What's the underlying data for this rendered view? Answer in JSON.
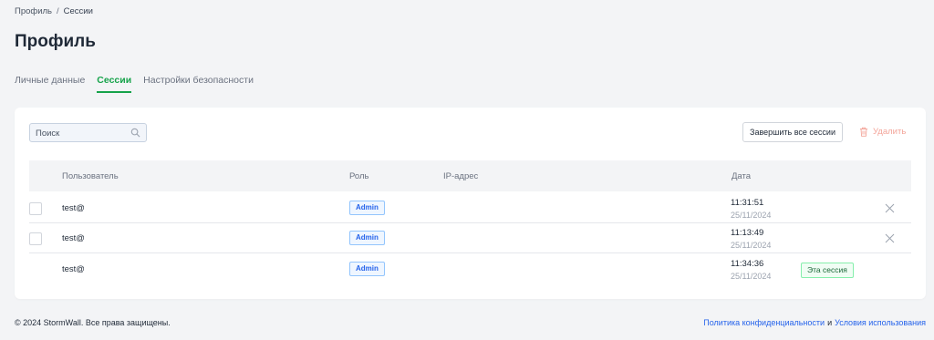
{
  "breadcrumb": {
    "parent": "Профиль",
    "separator": "/",
    "current": "Сессии"
  },
  "page": {
    "title": "Профиль"
  },
  "tabs": [
    {
      "label": "Личные данные",
      "active": false
    },
    {
      "label": "Сессии",
      "active": true
    },
    {
      "label": "Настройки безопасности",
      "active": false
    }
  ],
  "toolbar": {
    "search_placeholder": "Поиск",
    "end_all_label": "Завершить все сессии",
    "delete_label": "Удалить"
  },
  "table": {
    "columns": {
      "user": "Пользователь",
      "role": "Роль",
      "ip": "IP-адрес",
      "date": "Дата"
    },
    "rows": [
      {
        "user": "test@",
        "role": "Admin",
        "ip": "",
        "time": "11:31:51",
        "date": "25/11/2024"
      },
      {
        "user": "test@",
        "role": "Admin",
        "ip": "",
        "time": "11:13:49",
        "date": "25/11/2024"
      },
      {
        "user": "test@",
        "role": "Admin",
        "ip": "",
        "time": "11:34:36",
        "date": "25/11/2024",
        "badge": "Эта сессия"
      }
    ]
  },
  "footer": {
    "copyright": "© 2024 StormWall. Все права защищены.",
    "privacy_link": "Политика конфиденциальности",
    "conjunction": "и",
    "terms_link": "Условия использования"
  },
  "colors": {
    "accent": "#16a34a",
    "link": "#2563eb",
    "danger": "#f3a59a",
    "role_badge": "#2563eb"
  },
  "icons": {
    "search": "search-icon",
    "delete": "trash-icon",
    "row_close": "close-icon"
  }
}
